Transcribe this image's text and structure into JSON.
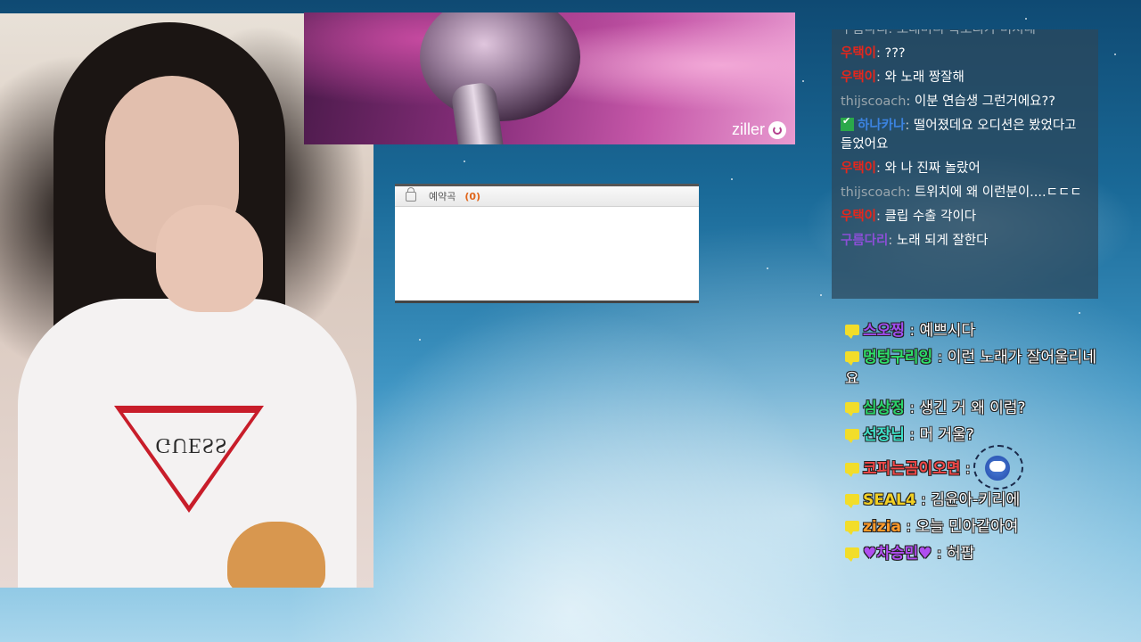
{
  "banner": {
    "logo_text": "ziller"
  },
  "webcam": {
    "shirt_brand": "GUESS"
  },
  "queue": {
    "title": "예약곡",
    "count": "(0)"
  },
  "chat_top": {
    "cutoff_line": "구름다리: 노래미디 목소리가 미쳐네",
    "messages": [
      {
        "user": "우택이",
        "sep": ":",
        "text": "???",
        "color": "red"
      },
      {
        "user": "우택이",
        "sep": ":",
        "text": "와 노래 짱잘해",
        "color": "red"
      },
      {
        "user": "thijscoach",
        "sep": ":",
        "text": "이분 연습생 그런거에요??",
        "color": "gray"
      },
      {
        "user": "하나카나",
        "sep": ":",
        "text": "떨어졌데요 오디션은 봤었다고 들었어요",
        "color": "blue",
        "verified": true
      },
      {
        "user": "우택이",
        "sep": ":",
        "text": "와 나 진짜 놀랐어",
        "color": "red"
      },
      {
        "user": "thijscoach",
        "sep": ":",
        "text": "트위치에 왜 이런분이....ㄷㄷㄷ",
        "color": "gray"
      },
      {
        "user": "우택이",
        "sep": ":",
        "text": "클립 수출 각이다",
        "color": "red"
      },
      {
        "user": "구름다리",
        "sep": ":",
        "text": "노래 되게 잘한다",
        "color": "purple"
      }
    ]
  },
  "chat_bottom": {
    "messages": [
      {
        "user": "스오찡",
        "text": "예쁘시다"
      },
      {
        "user": "멍텅구리잉",
        "text": "이런 노래가 잘어울리네요"
      },
      {
        "user": "심상정",
        "text": "생긴 거 왜 이럼?"
      },
      {
        "user": "선장님",
        "text": "머 거울?"
      },
      {
        "user": "코피는곰이오면",
        "text": ""
      },
      {
        "user": "SEAL4",
        "text": "김윤아-키리에"
      },
      {
        "user": "zizia",
        "text": "오늘 민아같아여"
      },
      {
        "user": "♥차승민♥",
        "text": "허팝"
      }
    ],
    "separator": " : "
  },
  "colors": {
    "accent_orange": "#e0651a",
    "chat_red": "#e8261b",
    "chat_blue": "#3b83e0",
    "chat_purple": "#8b4fd6",
    "bubble_yellow": "#f2dd2a"
  }
}
